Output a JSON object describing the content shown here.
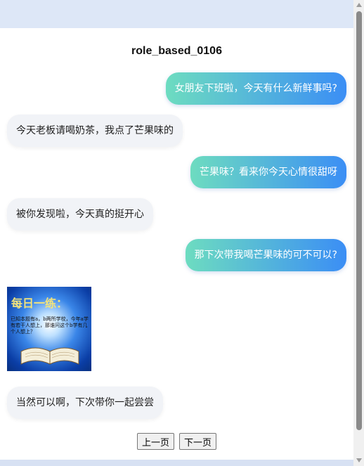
{
  "conversation": {
    "title": "role_based_0106",
    "messages": [
      {
        "role": "user",
        "text": "女朋友下班啦，今天有什么新鲜事吗?"
      },
      {
        "role": "bot",
        "text": "今天老板请喝奶茶，我点了芒果味的"
      },
      {
        "role": "user",
        "text": "芒果味？看来你今天心情很甜呀"
      },
      {
        "role": "bot",
        "text": "被你发现啦，今天真的挺开心"
      },
      {
        "role": "user",
        "text": "那下次带我喝芒果味的可不可以?"
      },
      {
        "role": "bot",
        "type": "image",
        "image_title": "每日一练：",
        "image_text": "已知本题有a，b两所学校，今年a学有若干人想上，那谁问这个b学有几个人想上？"
      },
      {
        "role": "bot",
        "text": "当然可以啊，下次带你一起尝尝"
      }
    ]
  },
  "pager": {
    "prev_label": "上一页",
    "next_label": "下一页"
  }
}
